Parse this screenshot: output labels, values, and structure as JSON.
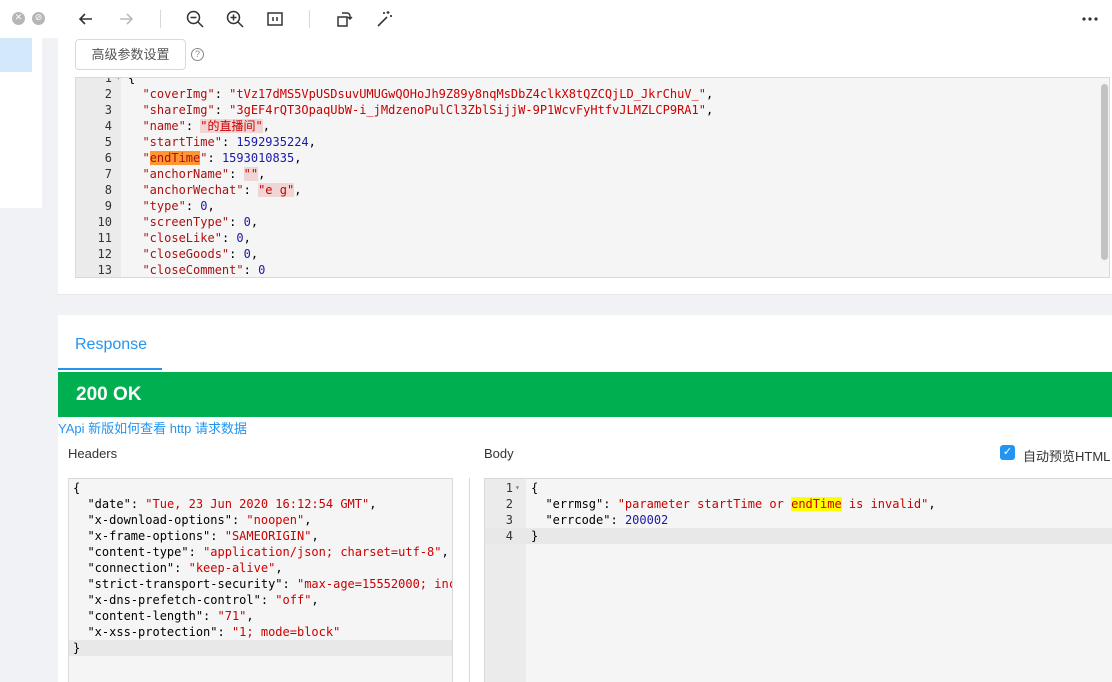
{
  "toolbar": {
    "icons": [
      "close-icon",
      "minimize-icon",
      "back-arrow-icon",
      "forward-arrow-icon",
      "zoom-out-icon",
      "zoom-in-icon",
      "fit-page-icon",
      "rotate-icon",
      "magic-wand-icon",
      "more-icon"
    ]
  },
  "request": {
    "advanced_button": "高级参数设置",
    "help_icon": "?",
    "lines": [
      {
        "no": "1",
        "text": "{"
      },
      {
        "no": "2",
        "key": "\"coverImg\"",
        "value": "\"tVz17dMS5VpUSDsuvUMUGwQOHoJh9Z89y8nqMsDbZ4clkX8tQZCQjLD_JkrChuV_\"",
        "type": "string"
      },
      {
        "no": "3",
        "key": "\"shareImg\"",
        "value": "\"3gEF4rQT3OpaqUbW-i_jMdzenoPulCl3ZblSijjW-9P1WcvFyHtfvJLMZLCP9RA1\"",
        "type": "string"
      },
      {
        "no": "4",
        "key": "\"name\"",
        "value": "\"的直播间\"",
        "type": "string-blur"
      },
      {
        "no": "5",
        "key": "\"startTime\"",
        "value": "1592935224",
        "type": "number"
      },
      {
        "no": "6",
        "key": "\"endTime\"",
        "value": "1593010835",
        "type": "number-hl"
      },
      {
        "no": "7",
        "key": "\"anchorName\"",
        "value": "\"\"",
        "type": "string-blur"
      },
      {
        "no": "8",
        "key": "\"anchorWechat\"",
        "value": "\"e g\"",
        "type": "string-blur"
      },
      {
        "no": "9",
        "key": "\"type\"",
        "value": "0",
        "type": "number"
      },
      {
        "no": "10",
        "key": "\"screenType\"",
        "value": "0",
        "type": "number"
      },
      {
        "no": "11",
        "key": "\"closeLike\"",
        "value": "0",
        "type": "number"
      },
      {
        "no": "12",
        "key": "\"closeGoods\"",
        "value": "0",
        "type": "number"
      },
      {
        "no": "13",
        "key": "\"closeComment\"",
        "value": "0",
        "type": "number-last"
      }
    ]
  },
  "response": {
    "tab_label": "Response",
    "status": "200 OK",
    "yapi_link": "YApi 新版如何查看 http 请求数据",
    "headers_title": "Headers",
    "body_title": "Body",
    "auto_preview_label": "自动预览HTML",
    "auto_preview_checked": true,
    "headers": [
      {
        "key": "\"date\"",
        "value": "\"Tue, 23 Jun 2020 16:12:54 GMT\""
      },
      {
        "key": "\"x-download-options\"",
        "value": "\"noopen\""
      },
      {
        "key": "\"x-frame-options\"",
        "value": "\"SAMEORIGIN\""
      },
      {
        "key": "\"content-type\"",
        "value": "\"application/json; charset=utf-8\""
      },
      {
        "key": "\"connection\"",
        "value": "\"keep-alive\""
      },
      {
        "key": "\"strict-transport-security\"",
        "value": "\"max-age=15552000; inc"
      },
      {
        "key": "\"x-dns-prefetch-control\"",
        "value": "\"off\""
      },
      {
        "key": "\"content-length\"",
        "value": "\"71\""
      },
      {
        "key": "\"x-xss-protection\"",
        "value": "\"1; mode=block\""
      }
    ],
    "body": {
      "errmsg_key": "\"errmsg\"",
      "errmsg_pre": "\"parameter startTime or ",
      "errmsg_hl": "endTime",
      "errmsg_post": " is invalid\"",
      "errcode_key": "\"errcode\"",
      "errcode_value": "200002",
      "line_numbers": [
        "1",
        "2",
        "3",
        "4"
      ]
    }
  }
}
